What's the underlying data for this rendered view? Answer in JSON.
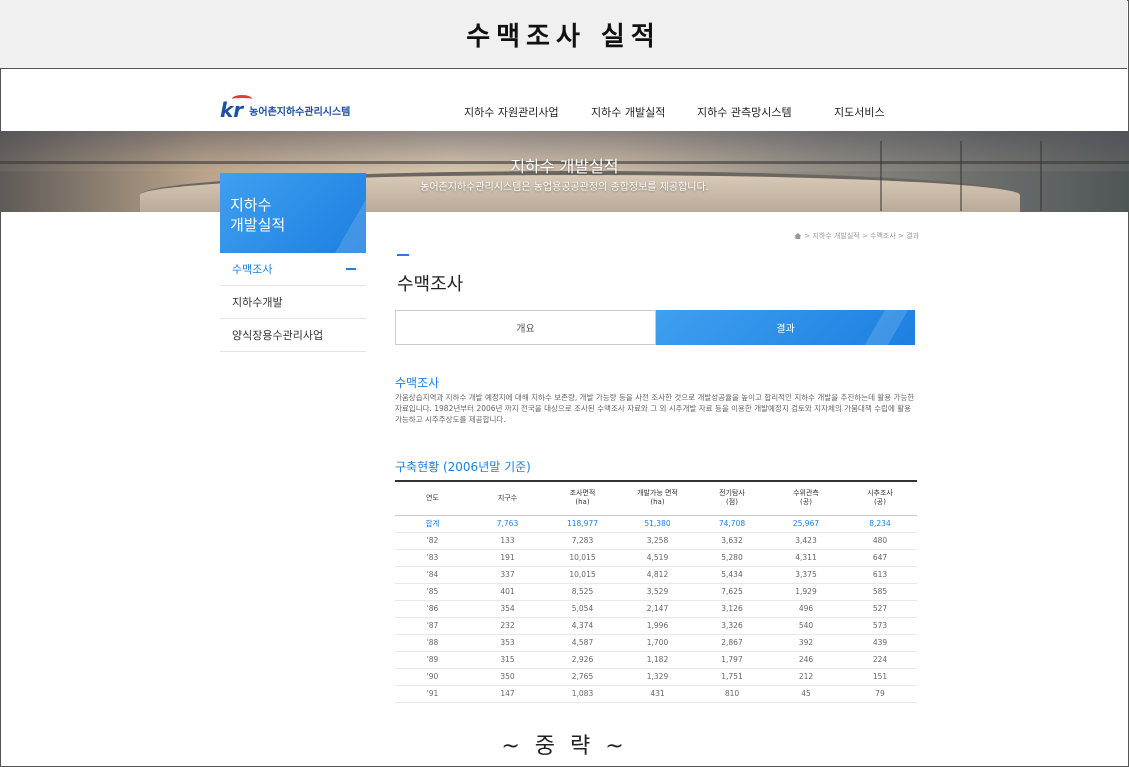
{
  "frame": {
    "title": "수맥조사 실적",
    "omit_text": "~ 중   략 ~"
  },
  "site": {
    "logo_mark": "kr",
    "logo_text": "농어촌지하수관리시스템",
    "nav": [
      "지하수 자원관리사업",
      "지하수 개발실적",
      "지하수 관측망시스템",
      "지도서비스"
    ]
  },
  "banner": {
    "title": "지하수 개발실적",
    "subtitle": "농어촌지하수관리시스템은 농업용공공관정의 종합정보를 제공합니다."
  },
  "sidebar": {
    "title_line1": "지하수",
    "title_line2": "개발실적",
    "items": [
      {
        "label": "수맥조사"
      },
      {
        "label": "지하수개발"
      },
      {
        "label": "양식장용수관리사업"
      }
    ]
  },
  "breadcrumb": {
    "text": "> 지하수 개발실적 > 수맥조사 > 결과"
  },
  "main": {
    "page_title": "수맥조사",
    "tabs": [
      {
        "label": "개요"
      },
      {
        "label": "결과"
      }
    ],
    "section_title": "수맥조사",
    "description": "가움상습지역과 지하수 개발 예정지에 대해 지하수 보존량, 개발 가능량 등을 사전 조사한 것으로 개발성공율을 높이고 합리적인 지하수 개발을 추진하는데 활용 가능한 자료입니다. 1982년부터 2006년 까지 전국을 대상으로 조사된 수맥조사 자료와 그 외 시추개발 자료 등을 이용한 개발예정지 검토와 지자체의 가뭄대책 수립에 활용가능하고 시추주상도를 제공합니다.",
    "table_title": "구축현황 (2006년말 기준)"
  },
  "table": {
    "headers": [
      [
        "연도",
        ""
      ],
      [
        "지구수",
        ""
      ],
      [
        "조사면적",
        "(ha)"
      ],
      [
        "개발가능 면적",
        "(ha)"
      ],
      [
        "전기탐사",
        "(점)"
      ],
      [
        "수위관측",
        "(공)"
      ],
      [
        "시추조사",
        "(공)"
      ]
    ],
    "rows": [
      [
        "합계",
        "7,763",
        "118,977",
        "51,380",
        "74,708",
        "25,967",
        "8,234"
      ],
      [
        "'82",
        "133",
        "7,283",
        "3,258",
        "3,632",
        "3,423",
        "480"
      ],
      [
        "'83",
        "191",
        "10,015",
        "4,519",
        "5,280",
        "4,311",
        "647"
      ],
      [
        "'84",
        "337",
        "10,015",
        "4,812",
        "5,434",
        "3,375",
        "613"
      ],
      [
        "'85",
        "401",
        "8,525",
        "3,529",
        "7,625",
        "1,929",
        "585"
      ],
      [
        "'86",
        "354",
        "5,054",
        "2,147",
        "3,126",
        "496",
        "527"
      ],
      [
        "'87",
        "232",
        "4,374",
        "1,996",
        "3,326",
        "540",
        "573"
      ],
      [
        "'88",
        "353",
        "4,587",
        "1,700",
        "2,867",
        "392",
        "439"
      ],
      [
        "'89",
        "315",
        "2,926",
        "1,182",
        "1,797",
        "246",
        "224"
      ],
      [
        "'90",
        "350",
        "2,765",
        "1,329",
        "1,751",
        "212",
        "151"
      ],
      [
        "'91",
        "147",
        "1,083",
        "431",
        "810",
        "45",
        "79"
      ]
    ]
  },
  "colors": {
    "accent": "#1d7fe0",
    "frame_header_bg": "#f0f0f0"
  }
}
